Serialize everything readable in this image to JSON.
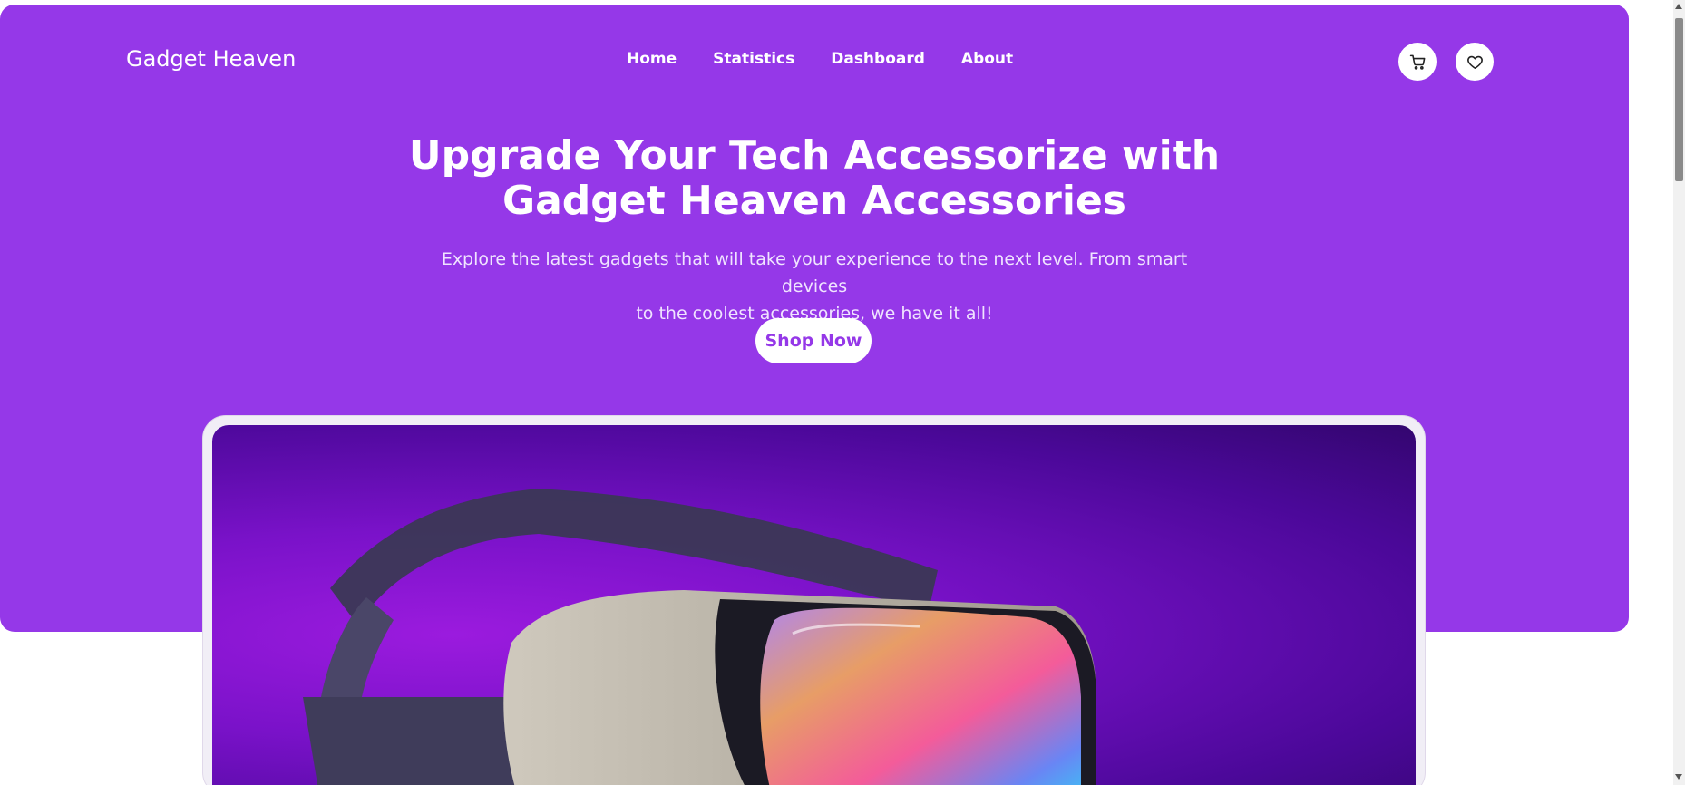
{
  "header": {
    "logo": "Gadget Heaven",
    "nav": [
      {
        "label": "Home"
      },
      {
        "label": "Statistics"
      },
      {
        "label": "Dashboard"
      },
      {
        "label": "About"
      }
    ],
    "icons": [
      "cart-icon",
      "heart-icon"
    ]
  },
  "hero": {
    "title_line1": "Upgrade Your Tech Accessorize with",
    "title_line2": "Gadget Heaven Accessories",
    "description_line1": "Explore the latest gadgets that will take your experience to the next level. From smart devices",
    "description_line2": "to the coolest accessories, we have it all!",
    "cta_label": "Shop Now"
  },
  "colors": {
    "brand": "#9538e8",
    "white": "#ffffff"
  }
}
